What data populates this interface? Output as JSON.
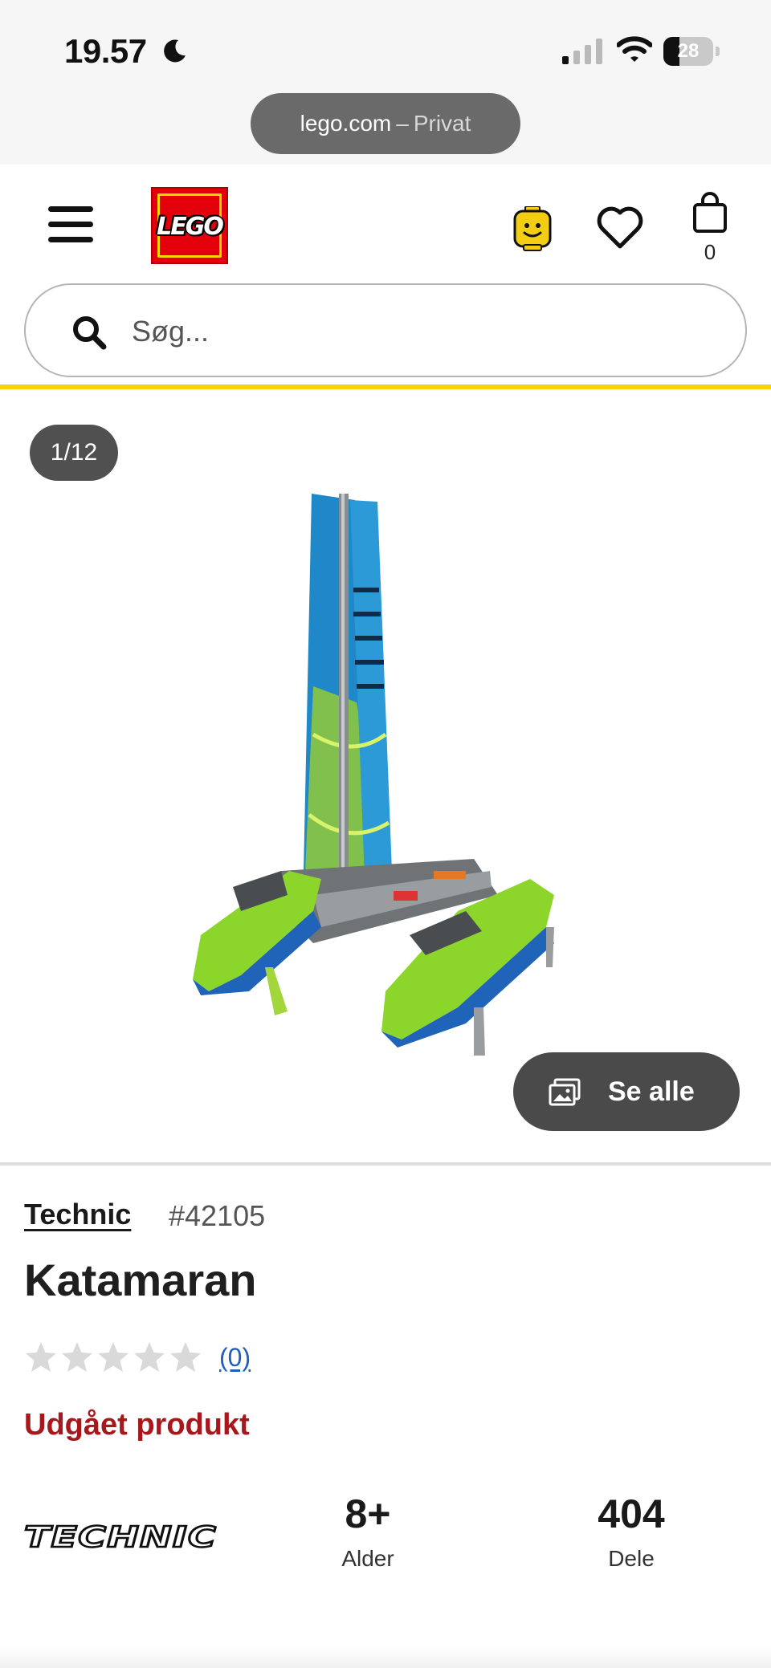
{
  "status_bar": {
    "time": "19.57",
    "battery_level": "28",
    "icons": [
      "moon-icon",
      "signal-icon",
      "wifi-icon",
      "battery-icon"
    ]
  },
  "browser": {
    "domain": "lego.com",
    "separator": "–",
    "mode": "Privat"
  },
  "header": {
    "logo_text": "LEGO",
    "cart_count": "0",
    "icons": [
      "menu-icon",
      "minifig-icon",
      "heart-icon",
      "bag-icon"
    ]
  },
  "search": {
    "placeholder": "Søg..."
  },
  "gallery": {
    "counter": "1/12",
    "see_all_label": "Se alle"
  },
  "product": {
    "theme": "Technic",
    "item_number": "#42105",
    "title": "Katamaran",
    "rating_stars": 0,
    "review_count": "(0)",
    "availability": "Udgået produkt"
  },
  "specs": {
    "brand_logo_text": "TECHNIC",
    "age_value": "8+",
    "age_label": "Alder",
    "pieces_value": "404",
    "pieces_label": "Dele"
  },
  "colors": {
    "lego_red": "#e3000b",
    "lego_yellow": "#f5d308",
    "unavailable_red": "#a8171b",
    "link_blue": "#1f5fbf",
    "badge_gray": "#505050"
  }
}
